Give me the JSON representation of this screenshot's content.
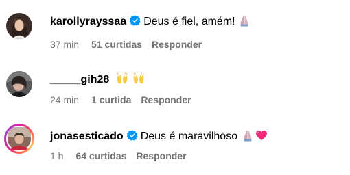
{
  "comments": [
    {
      "username": "karollyrayssaa",
      "verified": true,
      "text": "Deus é fiel, amém!",
      "emoji": "praying-hands-emoji",
      "time": "37 min",
      "likes": "51 curtidas",
      "reply": "Responder"
    },
    {
      "username": "_____gih28",
      "verified": false,
      "text": "",
      "emoji": "raising-hands-emoji",
      "time": "24 min",
      "likes": "1 curtida",
      "reply": "Responder"
    },
    {
      "username": "jonasesticado",
      "verified": true,
      "text": "Deus é maravilhoso",
      "emoji": "praying-hands-emoji",
      "time": "1 h",
      "likes": "64 curtidas",
      "reply": "Responder"
    }
  ],
  "colors": {
    "verified_blue": "#0095f6",
    "meta_gray": "#737373",
    "heart_pink": "#f4287a"
  }
}
